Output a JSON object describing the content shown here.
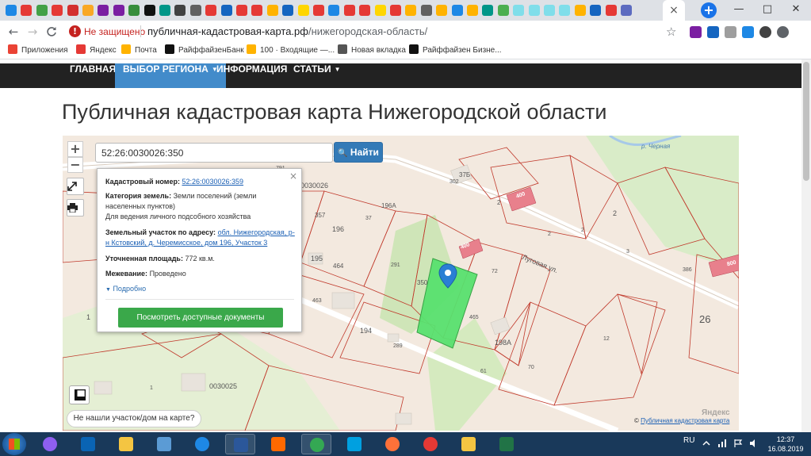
{
  "browser": {
    "tab_close": "×",
    "new_tab": "+",
    "window_controls": [
      "—",
      "□",
      "✕"
    ],
    "tab_favicon_colors": [
      "#1e88e5",
      "#e53935",
      "#43a047",
      "#e53935",
      "#d32f2f",
      "#f9a825",
      "#7b1fa2",
      "#7b1fa2",
      "#388e3c",
      "#111111",
      "#009688",
      "#424242",
      "#616161",
      "#e53935",
      "#1565c0",
      "#e53935",
      "#e53935",
      "#ffb300",
      "#1565c0",
      "#ffd600",
      "#e53935",
      "#1e88e5",
      "#e53935",
      "#e53935",
      "#ffd600",
      "#e53935",
      "#ffb300",
      "#616161",
      "#ffb300",
      "#1e88e5",
      "#ffb300",
      "#009688",
      "#4caf50",
      "#80deea",
      "#80deea",
      "#80deea",
      "#80deea",
      "#ffb300",
      "#1565c0",
      "#e53935",
      "#5c6bc0"
    ],
    "back": "←",
    "forward": "→",
    "reload": "C",
    "security_icon": "!",
    "security_text": "Не защищено",
    "url_domain": "публичная-кадастровая-карта.рф",
    "url_path": "/нижегородская-область/",
    "star": "☆",
    "extension_colors": [
      "#7b1fa2",
      "#1565c0",
      "#9e9e9e",
      "#1e88e5",
      "#424242",
      "#5f6368"
    ]
  },
  "bookmarks": [
    {
      "label": "Приложения",
      "icon": "apps-grid-icon",
      "color": "#ea4335"
    },
    {
      "label": "Яндекс",
      "icon": "yandex-icon",
      "color": "#e53935"
    },
    {
      "label": "Почта",
      "icon": "mail-icon",
      "color": "#ffb300"
    },
    {
      "label": "РайффайзенБанк",
      "icon": "raiffeisen-icon",
      "color": "#111111"
    },
    {
      "label": "100 · Входящие —...",
      "icon": "mail-icon",
      "color": "#ffb300"
    },
    {
      "label": "Новая вкладка",
      "icon": "globe-icon",
      "color": "#555555"
    },
    {
      "label": "Райффайзен Бизне...",
      "icon": "raiffeisen-icon",
      "color": "#111111"
    }
  ],
  "nav": [
    {
      "label": "ГЛАВНАЯ",
      "active": false,
      "caret": ""
    },
    {
      "label": "ВЫБОР РЕГИОНА",
      "active": true,
      "caret": "▼"
    },
    {
      "label": "ИНФОРМАЦИЯ",
      "active": false,
      "caret": ""
    },
    {
      "label": "СТАТЬИ",
      "active": false,
      "caret": "▼"
    }
  ],
  "page_title": "Публичная кадастровая карта Нижегородской области",
  "map": {
    "zoom_in": "+",
    "zoom_out": "−",
    "search_value": "52:26:0030026:350",
    "search_button": "Найти",
    "search_icon": "🔍",
    "popup": {
      "close": "×",
      "cadastral_label": "Кадастровый номер:",
      "cadastral_value": "52:26:0030026:359",
      "category_label": "Категория земель:",
      "category_value": "Земли поселений (земли населенных пунктов)",
      "category_use": "Для ведения личного подсобного хозяйства",
      "address_label": "Земельный участок по адресу:",
      "address_value": "обл. Нижегородская, р-н Кстовский, д. Черемисское, дом 196, Участок 3",
      "area_label": "Уточненная площадь:",
      "area_value": "772 кв.м.",
      "survey_label": "Межевание:",
      "survey_value": "Проведено",
      "more": "Подробно",
      "documents_button": "Посмотреть доступные документы"
    },
    "parcel_labels": [
      "0030026",
      "0030025",
      "37Б",
      "302",
      "357",
      "37",
      "196А",
      "196",
      "195",
      "464",
      "291",
      "350",
      "72",
      "463",
      "194",
      "289",
      "465",
      "198А",
      "61",
      "70",
      "12",
      "1",
      "2",
      "2",
      "2",
      "3",
      "386",
      "26",
      "2",
      "1",
      "791"
    ],
    "street": "Луговая ул.",
    "river": "р. Черная",
    "badges": [
      "400",
      "400",
      "800"
    ],
    "not_found": "Не нашли участок/дом на карте?",
    "attribution": "Публичная кадастровая карта",
    "attribution_prefix": "©",
    "yandex": "Яндекс"
  },
  "taskbar": {
    "apps": [
      {
        "name": "alice",
        "color": "#8e5ff0",
        "open": false
      },
      {
        "name": "outlook",
        "color": "#0a64b4",
        "open": false
      },
      {
        "name": "explorer",
        "color": "#f4c542",
        "open": false
      },
      {
        "name": "media",
        "color": "#5b9bd5",
        "open": false
      },
      {
        "name": "ie",
        "color": "#1e88e5",
        "open": false
      },
      {
        "name": "word",
        "color": "#2b579a",
        "open": true
      },
      {
        "name": "mi",
        "color": "#ff6900",
        "open": false
      },
      {
        "name": "chrome",
        "color": "#34a853",
        "open": true
      },
      {
        "name": "scanner",
        "color": "#00a0e0",
        "open": false
      },
      {
        "name": "firefox",
        "color": "#ff7139",
        "open": false
      },
      {
        "name": "yandex-browser",
        "color": "#e53935",
        "open": false
      },
      {
        "name": "folder",
        "color": "#f4c542",
        "open": false
      },
      {
        "name": "excel",
        "color": "#217346",
        "open": false
      }
    ],
    "lang": "RU",
    "time": "12:37",
    "date": "16.08.2019"
  }
}
